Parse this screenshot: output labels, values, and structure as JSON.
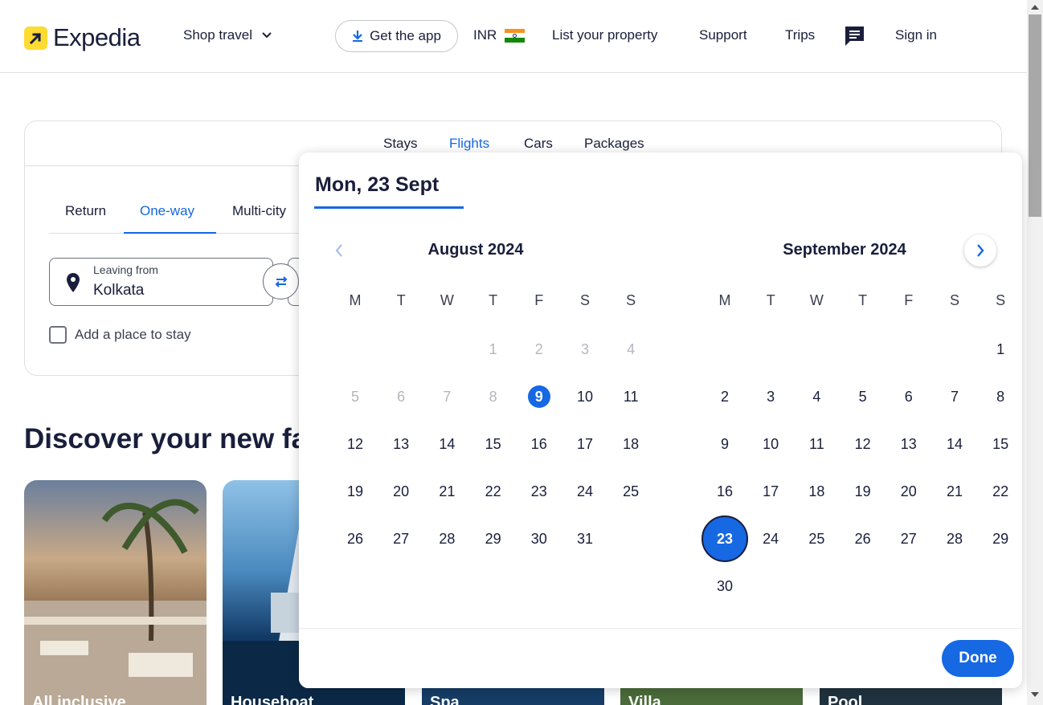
{
  "header": {
    "brand": "Expedia",
    "shop_travel": "Shop travel",
    "get_app": "Get the app",
    "currency": "INR",
    "list_property": "List your property",
    "support": "Support",
    "trips": "Trips",
    "sign_in": "Sign in"
  },
  "search": {
    "tabs": [
      "Stays",
      "Flights",
      "Cars",
      "Packages"
    ],
    "active_tab": "Flights",
    "trip_types": [
      "Return",
      "One-way",
      "Multi-city"
    ],
    "active_trip_type": "One-way",
    "leaving_from_label": "Leaving from",
    "leaving_from_value": "Kolkata",
    "add_stay_label": "Add a place to stay"
  },
  "discover": {
    "heading": "Discover your new fav",
    "tiles": [
      "All inclusive",
      "Houseboat",
      "Spa",
      "Villa",
      "Pool"
    ]
  },
  "calendar": {
    "selected_date_label": "Mon, 23 Sept",
    "weekdays": [
      "M",
      "T",
      "W",
      "T",
      "F",
      "S",
      "S"
    ],
    "months": [
      {
        "title": "August 2024",
        "weeks": [
          [
            "",
            "",
            "",
            "1",
            "2",
            "3",
            "4"
          ],
          [
            "5",
            "6",
            "7",
            "8",
            "9",
            "10",
            "11"
          ],
          [
            "12",
            "13",
            "14",
            "15",
            "16",
            "17",
            "18"
          ],
          [
            "19",
            "20",
            "21",
            "22",
            "23",
            "24",
            "25"
          ],
          [
            "26",
            "27",
            "28",
            "29",
            "30",
            "31",
            ""
          ]
        ],
        "disabled_through": 8,
        "today": 9
      },
      {
        "title": "September 2024",
        "weeks": [
          [
            "",
            "",
            "",
            "",
            "",
            "",
            "1"
          ],
          [
            "2",
            "3",
            "4",
            "5",
            "6",
            "7",
            "8"
          ],
          [
            "9",
            "10",
            "11",
            "12",
            "13",
            "14",
            "15"
          ],
          [
            "16",
            "17",
            "18",
            "19",
            "20",
            "21",
            "22"
          ],
          [
            "23",
            "24",
            "25",
            "26",
            "27",
            "28",
            "29"
          ],
          [
            "30",
            "",
            "",
            "",
            "",
            "",
            ""
          ]
        ],
        "selected": 23
      }
    ],
    "done_label": "Done"
  },
  "colors": {
    "accent": "#1668e3",
    "text": "#191e3b",
    "brand_yellow": "#fddb32"
  }
}
